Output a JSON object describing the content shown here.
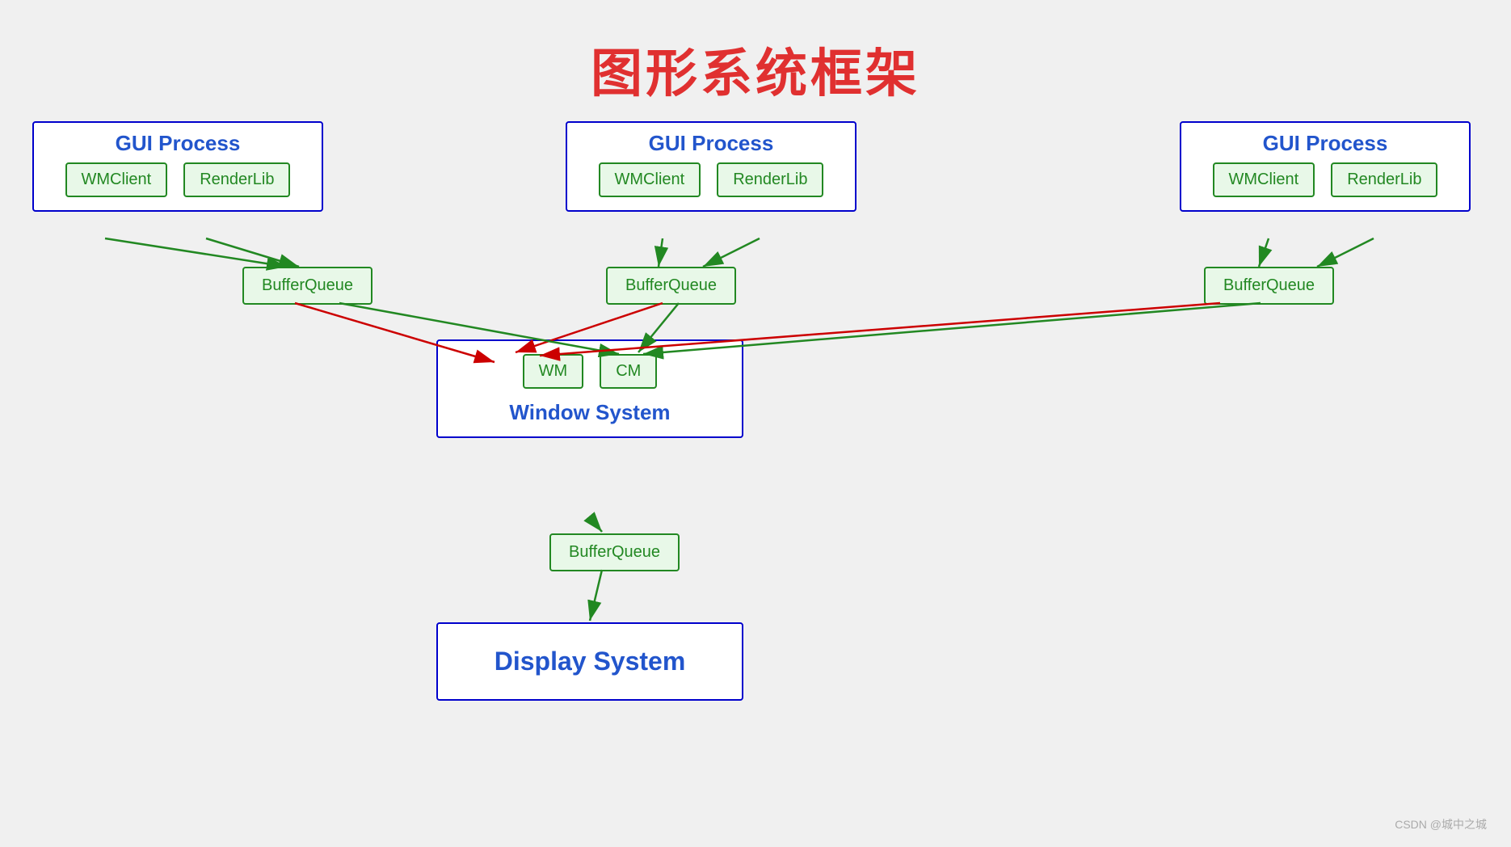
{
  "title": "图形系统框架",
  "gui_boxes": [
    {
      "id": "gui1",
      "label": "GUI Process",
      "items": [
        "WMClient",
        "RenderLib"
      ]
    },
    {
      "id": "gui2",
      "label": "GUI Process",
      "items": [
        "WMClient",
        "RenderLib"
      ]
    },
    {
      "id": "gui3",
      "label": "GUI Process",
      "items": [
        "WMClient",
        "RenderLib"
      ]
    }
  ],
  "buffer_queues": [
    {
      "id": "bq1",
      "label": "BufferQueue"
    },
    {
      "id": "bq2",
      "label": "BufferQueue"
    },
    {
      "id": "bq3",
      "label": "BufferQueue"
    }
  ],
  "window_system": {
    "label": "Window System",
    "components": [
      "WM",
      "CM"
    ]
  },
  "bottom_buffer": "BufferQueue",
  "display_system": "Display System",
  "watermark": "CSDN @城中之城",
  "colors": {
    "title_red": "#e03030",
    "blue_border": "#0000cc",
    "blue_text": "#2255cc",
    "green_border": "#228822",
    "green_bg": "#e8f8e8",
    "green_text": "#228822",
    "arrow_red": "#cc0000",
    "arrow_green": "#228822"
  }
}
